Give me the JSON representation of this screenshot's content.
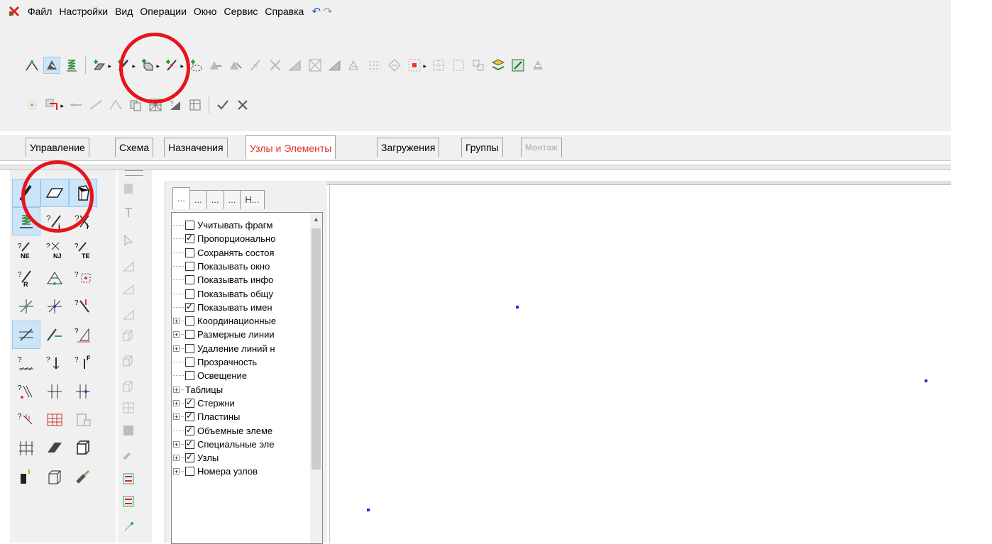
{
  "menu": {
    "items": [
      "Файл",
      "Настройки",
      "Вид",
      "Операции",
      "Окно",
      "Сервис",
      "Справка"
    ],
    "undo_icon": "undo-icon",
    "redo_icon": "redo-icon"
  },
  "main_tabs": [
    {
      "label": "Управление"
    },
    {
      "label": "Схема"
    },
    {
      "label": "Назначения"
    },
    {
      "label": "Узлы и Элементы",
      "active": true
    },
    {
      "label": "Загружения"
    },
    {
      "label": "Группы"
    },
    {
      "label": "Монтаж",
      "disabled": true
    }
  ],
  "tree_tabs": [
    "...",
    "...",
    "...",
    "...",
    "Н..."
  ],
  "tree_items": [
    {
      "label": "Учитывать фрагм",
      "checked": false,
      "expandable": false
    },
    {
      "label": "Пропорционально",
      "checked": true,
      "expandable": false
    },
    {
      "label": "Сохранять состоя",
      "checked": false,
      "expandable": false
    },
    {
      "label": "Показывать окно",
      "checked": false,
      "expandable": false
    },
    {
      "label": "Показывать инфо",
      "checked": false,
      "expandable": false
    },
    {
      "label": "Показывать общу",
      "checked": false,
      "expandable": false
    },
    {
      "label": "Показывать имен",
      "checked": true,
      "expandable": false
    },
    {
      "label": "Координационные",
      "checked": false,
      "expandable": true
    },
    {
      "label": "Размерные линии",
      "checked": false,
      "expandable": true
    },
    {
      "label": "Удаление линий н",
      "checked": false,
      "expandable": true
    },
    {
      "label": "Прозрачность",
      "checked": false,
      "expandable": false
    },
    {
      "label": "Освещение",
      "checked": false,
      "expandable": false
    },
    {
      "label": "Таблицы",
      "checked": null,
      "expandable": true
    },
    {
      "label": "Стержни",
      "checked": true,
      "expandable": true
    },
    {
      "label": "Пластины",
      "checked": true,
      "expandable": true
    },
    {
      "label": "Объемные элеме",
      "checked": true,
      "expandable": false
    },
    {
      "label": "Специальные эле",
      "checked": true,
      "expandable": true
    },
    {
      "label": "Узлы",
      "checked": true,
      "expandable": true
    },
    {
      "label": "Номера узлов",
      "checked": false,
      "expandable": true
    }
  ],
  "colors": {
    "active_tab_text": "#e03030",
    "annotation": "#e8141b",
    "node_point": "#1a2bdc",
    "pressed_bg": "#cce4f7"
  }
}
